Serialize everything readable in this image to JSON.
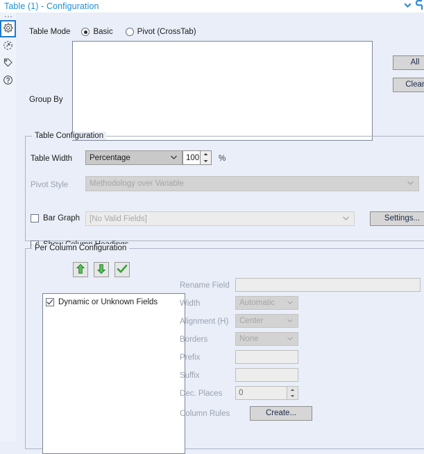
{
  "window": {
    "title": "Table (1) - Configuration",
    "icons": [
      {
        "name": "chevron-down-icon"
      },
      {
        "name": "undo-arrow-icon"
      }
    ]
  },
  "rail": {
    "items": [
      {
        "name": "gear-icon",
        "label": "Configuration",
        "selected": true
      },
      {
        "name": "refresh-circle-icon",
        "label": "Refresh",
        "selected": false
      },
      {
        "name": "tag-icon",
        "label": "Annotation",
        "selected": false
      },
      {
        "name": "help-circle-icon",
        "label": "Help",
        "selected": false
      }
    ]
  },
  "table_mode": {
    "label": "Table Mode",
    "options": [
      {
        "label": "Basic",
        "selected": true
      },
      {
        "label": "Pivot (CrossTab)",
        "selected": false
      }
    ]
  },
  "group_by": {
    "label": "Group By",
    "items": [],
    "all_button": "All",
    "clear_button": "Clear"
  },
  "table_configuration": {
    "title": "Table Configuration",
    "table_width": {
      "label": "Table Width",
      "mode_value": "Percentage",
      "amount": "100",
      "unit": "%"
    },
    "pivot_style": {
      "label": "Pivot Style",
      "value": "Methodology over Variable",
      "disabled": true
    },
    "bar_graph": {
      "label": "Bar Graph",
      "checked": false,
      "field_value": "[No Valid Fields]",
      "settings_button": "Settings..."
    },
    "show_column_headings": {
      "label": "Show Column Headings",
      "checked": true
    }
  },
  "per_column_configuration": {
    "title": "Per Column Configuration",
    "toolbar": [
      {
        "name": "move-up-icon",
        "label": "Move Up"
      },
      {
        "name": "move-down-icon",
        "label": "Move Down"
      },
      {
        "name": "check-icon",
        "label": "Apply"
      }
    ],
    "fields": [
      {
        "label": "Dynamic or Unknown Fields",
        "checked": true
      }
    ],
    "properties": {
      "rename_field": {
        "label": "Rename Field",
        "value": ""
      },
      "width": {
        "label": "Width",
        "value": "Automatic"
      },
      "alignment": {
        "label": "Alignment (H)",
        "value": "Center"
      },
      "borders": {
        "label": "Borders",
        "value": "None"
      },
      "prefix": {
        "label": "Prefix",
        "value": ""
      },
      "suffix": {
        "label": "Suffix",
        "value": ""
      },
      "dec_places": {
        "label": "Dec. Places",
        "value": "0"
      },
      "column_rules": {
        "label": "Column Rules",
        "button": "Create..."
      }
    }
  },
  "colors": {
    "background": "#e9eef8",
    "title_blue": "#1e8fd5",
    "accent_blue": "#2079c8",
    "green": "#3aa03a",
    "button_face": "#d6d6d6"
  }
}
